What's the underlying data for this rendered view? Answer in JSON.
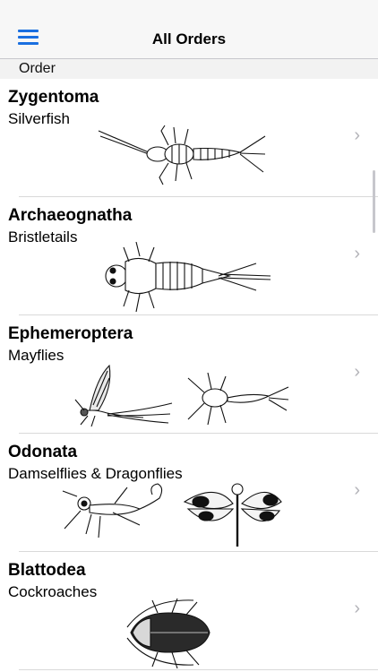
{
  "navbar": {
    "title": "All Orders",
    "menu_icon": "hamburger-menu-icon"
  },
  "section": {
    "header": "Order"
  },
  "orders": [
    {
      "name": "Zygentoma",
      "common": "Silverfish"
    },
    {
      "name": "Archaeognatha",
      "common": "Bristletails"
    },
    {
      "name": "Ephemeroptera",
      "common": "Mayflies"
    },
    {
      "name": "Odonata",
      "common": "Damselflies & Dragonflies"
    },
    {
      "name": "Blattodea",
      "common": "Cockroaches"
    }
  ],
  "chevron_glyph": "›",
  "colors": {
    "accent": "#1a6fe0",
    "separator": "#d9d9d9",
    "chevron": "#b3b3b8"
  }
}
